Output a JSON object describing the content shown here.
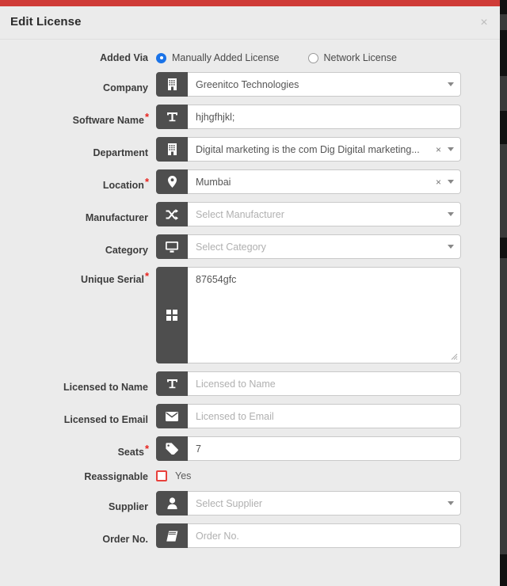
{
  "window": {
    "title": "Edit License",
    "close_label": "×",
    "accent_color": "#cf3b37",
    "addon_color": "#4e4e4e",
    "required_color": "#e8211c",
    "radio_selected_color": "#1a73e8",
    "checkbox_color": "#e8413c"
  },
  "form": {
    "added_via": {
      "label": "Added Via",
      "options": [
        {
          "label": "Manually Added License",
          "selected": true
        },
        {
          "label": "Network License",
          "selected": false
        }
      ]
    },
    "fields": [
      {
        "label": "Company",
        "required": false,
        "icon": "building-icon",
        "value": "Greenitco Technologies",
        "is_placeholder": false,
        "has_caret": true,
        "has_clear": false
      },
      {
        "label": "Software Name",
        "required": true,
        "icon": "text-height-icon",
        "value": "hjhgfhjkl;",
        "is_placeholder": false,
        "has_caret": false,
        "has_clear": false
      },
      {
        "label": "Department",
        "required": false,
        "icon": "building-icon",
        "value": "Digital marketing is the com Dig Digital marketing...",
        "is_placeholder": false,
        "has_caret": true,
        "has_clear": true
      },
      {
        "label": "Location",
        "required": true,
        "icon": "map-pin-icon",
        "value": "Mumbai",
        "is_placeholder": false,
        "has_caret": true,
        "has_clear": true
      },
      {
        "label": "Manufacturer",
        "required": false,
        "icon": "shuffle-icon",
        "value": "Select Manufacturer",
        "is_placeholder": true,
        "has_caret": true,
        "has_clear": false
      },
      {
        "label": "Category",
        "required": false,
        "icon": "monitor-icon",
        "value": "Select Category",
        "is_placeholder": true,
        "has_caret": true,
        "has_clear": false
      }
    ],
    "unique_serial": {
      "label": "Unique Serial",
      "required": true,
      "icon": "grid-icon",
      "value": "87654gfc"
    },
    "fields_lower": [
      {
        "label": "Licensed to Name",
        "required": false,
        "icon": "text-height-icon",
        "value": "Licensed to Name",
        "is_placeholder": true,
        "has_caret": false,
        "has_clear": false
      },
      {
        "label": "Licensed to Email",
        "required": false,
        "icon": "envelope-icon",
        "value": "Licensed to Email",
        "is_placeholder": true,
        "has_caret": false,
        "has_clear": false
      },
      {
        "label": "Seats",
        "required": true,
        "icon": "tag-icon",
        "value": "7",
        "is_placeholder": false,
        "has_caret": false,
        "has_clear": false
      }
    ],
    "reassignable": {
      "label": "Reassignable",
      "checkbox_label": "Yes",
      "checked": false
    },
    "fields_tail": [
      {
        "label": "Supplier",
        "required": false,
        "icon": "user-icon",
        "value": "Select Supplier",
        "is_placeholder": true,
        "has_caret": true,
        "has_clear": false
      },
      {
        "label": "Order No.",
        "required": false,
        "icon": "book-icon",
        "value": "Order No.",
        "is_placeholder": true,
        "has_caret": false,
        "has_clear": false
      }
    ]
  }
}
